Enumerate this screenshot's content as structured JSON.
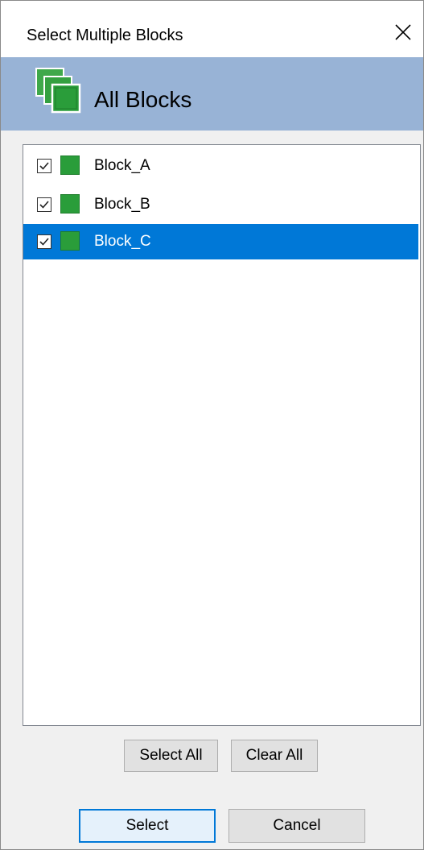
{
  "window": {
    "title": "Select Multiple Blocks",
    "close_glyph": "✕"
  },
  "banner": {
    "icon": "stacked-blocks-icon",
    "title": "All Blocks"
  },
  "list": {
    "items": [
      {
        "label": "Block_A",
        "checked": true,
        "selected": false,
        "color": "#2a9d3a"
      },
      {
        "label": "Block_B",
        "checked": true,
        "selected": false,
        "color": "#2a9d3a"
      },
      {
        "label": "Block_C",
        "checked": true,
        "selected": true,
        "color": "#2a9d3a"
      }
    ]
  },
  "list_actions": {
    "select_all_label": "Select All",
    "clear_all_label": "Clear All"
  },
  "footer": {
    "select_label": "Select",
    "cancel_label": "Cancel"
  },
  "colors": {
    "banner": "#98b3d6",
    "selection": "#0078d7",
    "block_green": "#2a9d3a"
  }
}
